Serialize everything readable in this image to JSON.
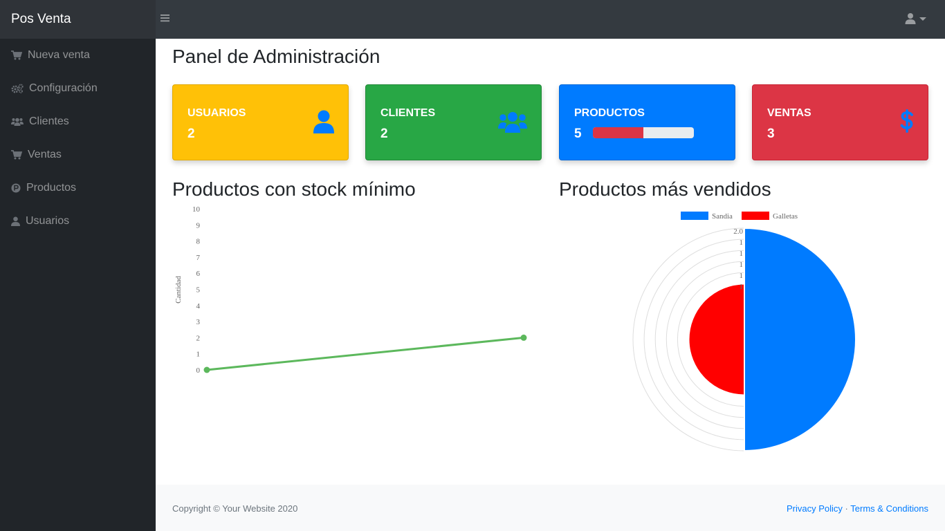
{
  "app": {
    "brand": "Pos Venta"
  },
  "sidebar": {
    "items": [
      {
        "label": "Nueva venta",
        "icon": "cart-icon"
      },
      {
        "label": "Configuración",
        "icon": "cogs-icon"
      },
      {
        "label": "Clientes",
        "icon": "users-icon"
      },
      {
        "label": "Ventas",
        "icon": "cart-icon"
      },
      {
        "label": "Productos",
        "icon": "product-icon"
      },
      {
        "label": "Usuarios",
        "icon": "user-icon"
      }
    ]
  },
  "main": {
    "title": "Panel de Administración",
    "cards": [
      {
        "label": "USUARIOS",
        "value": "2",
        "color": "#ffc107",
        "icon": "user-icon"
      },
      {
        "label": "CLIENTES",
        "value": "2",
        "color": "#28a745",
        "icon": "users-icon"
      },
      {
        "label": "PRODUCTOS",
        "value": "5",
        "color": "#007bff",
        "progress": 0.5
      },
      {
        "label": "VENTAS",
        "value": "3",
        "color": "#dc3545",
        "icon": "dollar-icon"
      }
    ],
    "stock_title": "Productos con stock mínimo",
    "sold_title": "Productos más vendidos"
  },
  "chart_data": [
    {
      "type": "line",
      "title": "",
      "ylabel": "Cantidad",
      "xlabel": "",
      "y_ticks": [
        "10",
        "9",
        "8",
        "7",
        "6",
        "5",
        "4",
        "3",
        "2",
        "1",
        "0"
      ],
      "ylim": [
        0,
        10
      ],
      "series": [
        {
          "values": [
            0,
            2
          ],
          "color": "#5cb85c"
        }
      ],
      "grid": false
    },
    {
      "type": "pie",
      "subtype": "polar-area",
      "legend": "top",
      "categories": [
        "Sandia",
        "Galletas"
      ],
      "values": [
        2,
        1
      ],
      "colors": [
        "#007bff",
        "#ff0000"
      ],
      "r_ticks": [
        "2.0",
        "1",
        "1",
        "1",
        "1",
        "1"
      ],
      "rlim": [
        0,
        2
      ]
    }
  ],
  "footer": {
    "copyright": "Copyright © Your Website 2020",
    "privacy": "Privacy Policy",
    "separator": "·",
    "terms": "Terms & Conditions"
  }
}
